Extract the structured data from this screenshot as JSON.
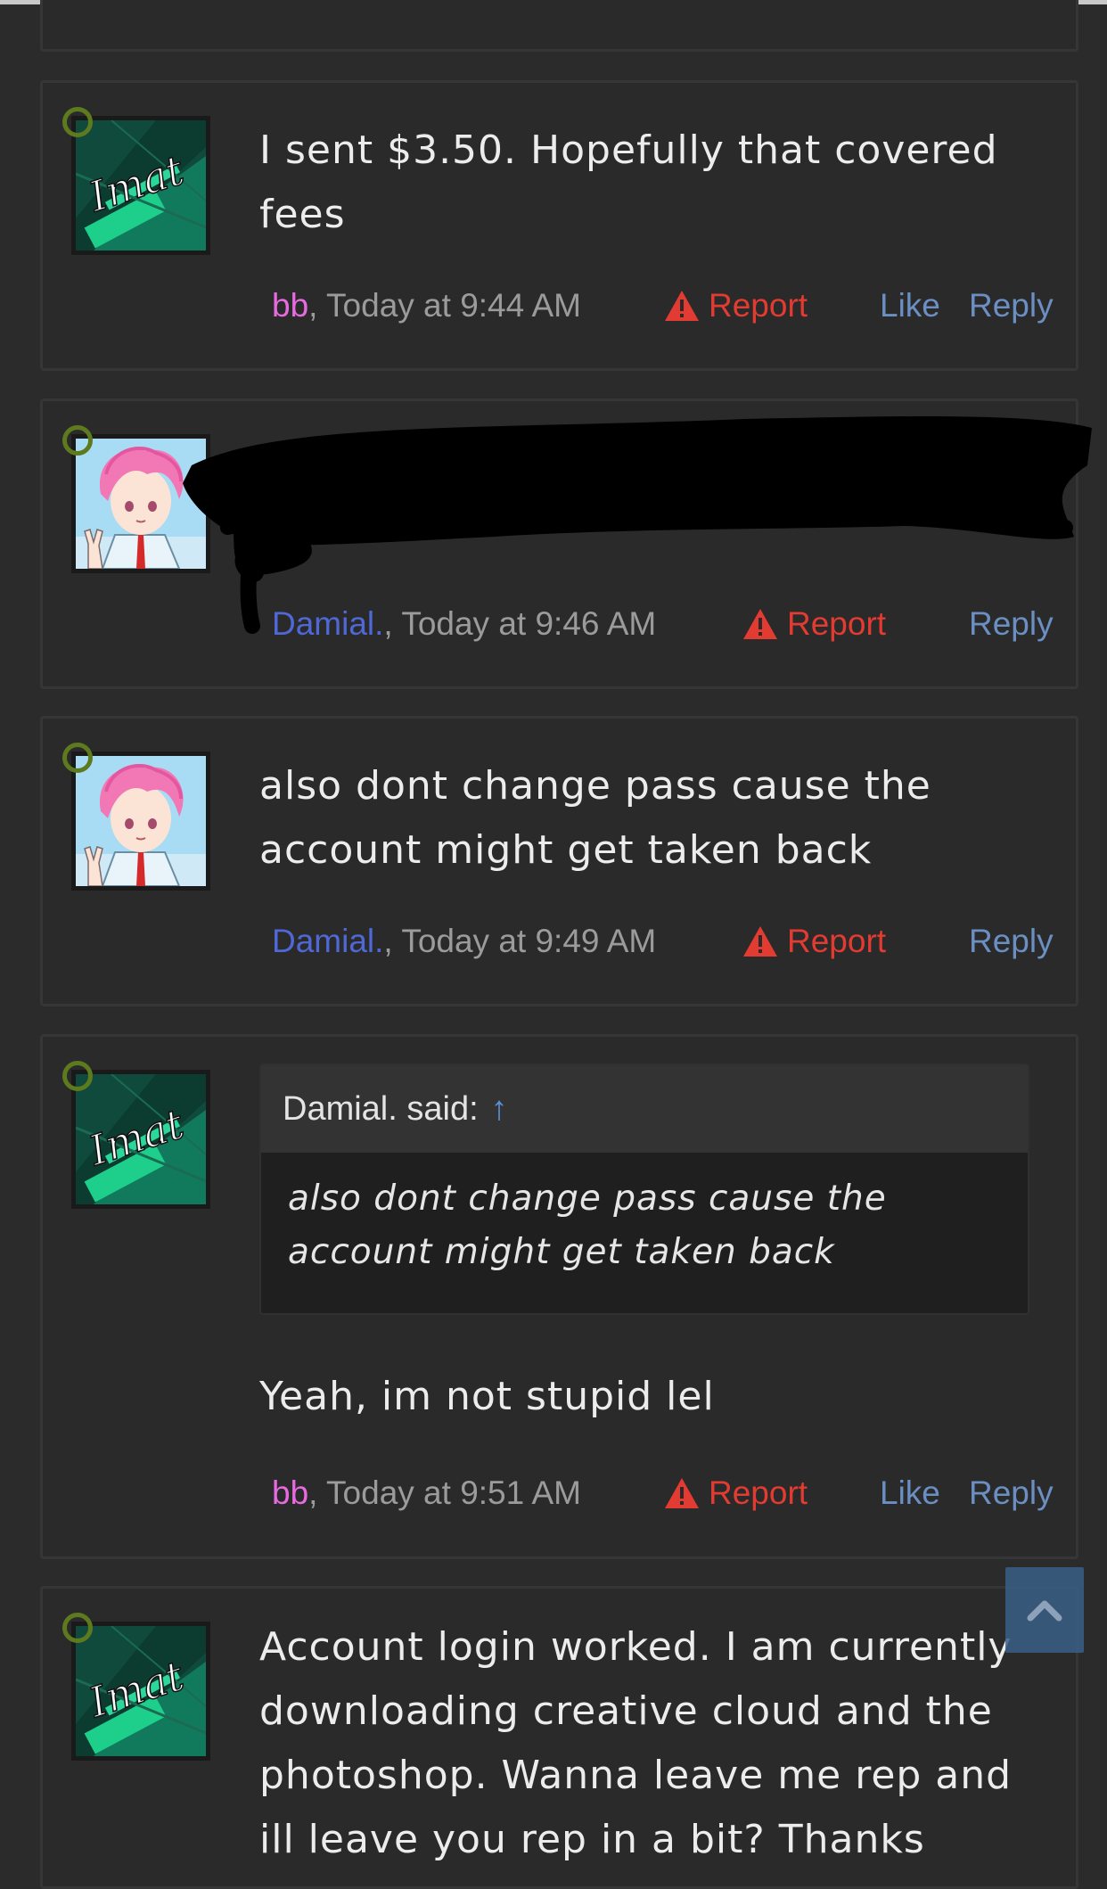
{
  "posts": [
    {
      "message": "I sent $3.50. Hopefully that covered fees",
      "user": "bb",
      "user_color": "#e86ae0",
      "time": ", Today at 9:44 AM",
      "report_label": "Report",
      "like_label": "Like",
      "reply_label": "Reply",
      "avatar": "dark-green-logo"
    },
    {
      "message": "",
      "user": "Damial.",
      "user_color": "#4f68d6",
      "time": ", Today at 9:46 AM",
      "report_label": "Report",
      "reply_label": "Reply",
      "avatar": "anime-pink-hair"
    },
    {
      "message": "also dont change pass cause the account might get taken back",
      "user": "Damial.",
      "user_color": "#4f68d6",
      "time": ", Today at 9:49 AM",
      "report_label": "Report",
      "reply_label": "Reply",
      "avatar": "anime-pink-hair"
    },
    {
      "quote_author": "Damial. said:",
      "quote_arrow": "↑",
      "quote_text": "also dont change pass cause the account might get taken back",
      "message": "Yeah, im not stupid lel",
      "user": "bb",
      "user_color": "#e86ae0",
      "time": ", Today at 9:51 AM",
      "report_label": "Report",
      "like_label": "Like",
      "reply_label": "Reply",
      "avatar": "dark-green-logo"
    },
    {
      "message": "Account login worked. I am currently downloading creative cloud and the photoshop. Wanna leave me rep and ill leave you rep in a bit? Thanks",
      "avatar": "dark-green-logo"
    }
  ],
  "colors": {
    "report": "#e23b31",
    "action_link": "#6b8fc2",
    "status_ring": "#5e7a1f",
    "scroll_button": "#3a5f86"
  },
  "icons": {
    "report": "warning-triangle-icon",
    "quote_jump": "up-arrow-icon",
    "scroll_top": "chevron-up-icon"
  }
}
